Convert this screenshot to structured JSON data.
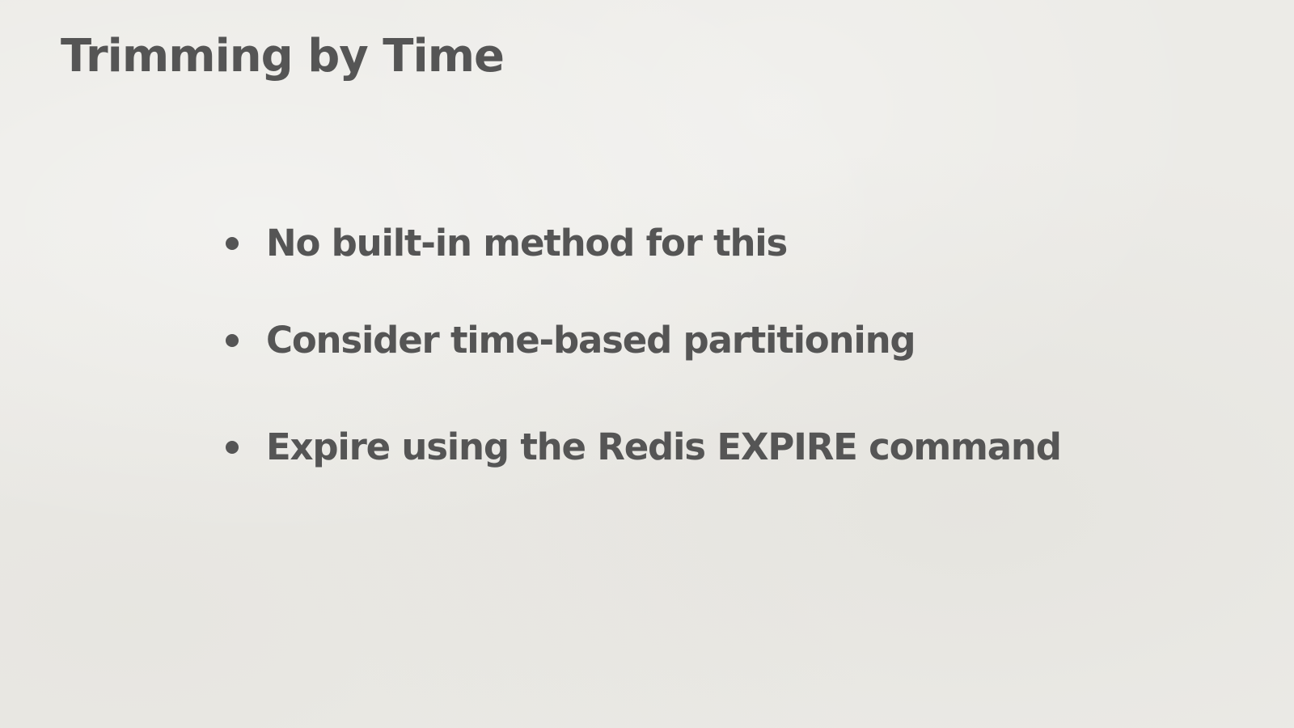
{
  "slide": {
    "title": "Trimming by Time",
    "bullets": [
      "No built-in method for this",
      "Consider time-based partitioning",
      "Expire using the Redis EXPIRE command"
    ]
  },
  "colors": {
    "background": "#ecebe7",
    "text": "#555555"
  }
}
